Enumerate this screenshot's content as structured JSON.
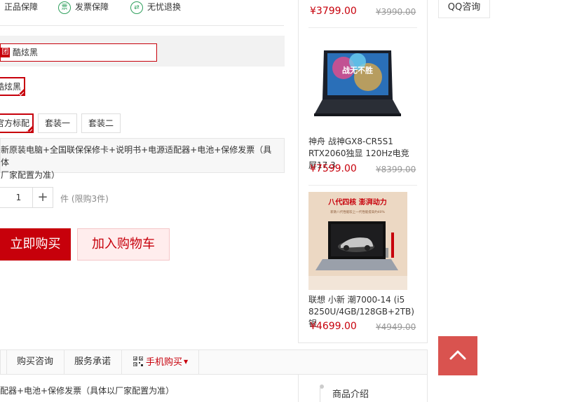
{
  "guarantees": [
    {
      "label": "正品保障"
    },
    {
      "label": "发票保障",
      "icon": "invoice-icon",
      "glyph": "票"
    },
    {
      "label": "无忧退换",
      "icon": "exchange-icon",
      "glyph": "⇄"
    }
  ],
  "promo": {
    "tag": "团",
    "text": "酷炫黑"
  },
  "color_option": {
    "label": "酷炫黑"
  },
  "package_options": [
    "官方标配",
    "套装一",
    "套装二"
  ],
  "package_desc": "新原装电脑+全国联保保修卡+说明书+电源适配器+电池+保修发票（具体以厂家配置为准）",
  "package_desc_lines": [
    "新原装电脑+全国联保保修卡+说明书+电源适配器+电池+保修发票（具体",
    "厂家配置为准）"
  ],
  "quantity": {
    "value": "1",
    "plus": "+",
    "unit": "件",
    "limit": "(限购3件)"
  },
  "buttons": {
    "buy_now": "立即购买",
    "add_cart": "加入购物车"
  },
  "recommendations": [
    {
      "price": "¥3799.00",
      "old_price": "¥3990.00"
    },
    {
      "name": "神舟 战神GX8-CR5S1 RTX2060独显 120Hz电竞屏17.3",
      "price": "¥7599.00",
      "old_price": "¥8399.00",
      "screen_text": "战无不胜"
    },
    {
      "name": "联想 小新 潮7000-14 (i5 8250U/4GB/128GB+2TB) 银",
      "price": "¥4699.00",
      "old_price": "¥4949.00",
      "ad_headline": "八代四核 澎湃动力",
      "ad_sub": "新款八代性能较上一代性能提高约40%"
    }
  ],
  "sidebar": {
    "qq": "QQ咨询"
  },
  "tabs": [
    "购买咨询",
    "服务承诺",
    "手机购买"
  ],
  "detail_text": "配器+电池+保修发票（具体以厂家配置为准）",
  "side_nav": {
    "item": "商品介绍"
  },
  "colors": {
    "accent": "#c7000b",
    "green": "#2e9f5c",
    "totop": "#d9534f"
  }
}
